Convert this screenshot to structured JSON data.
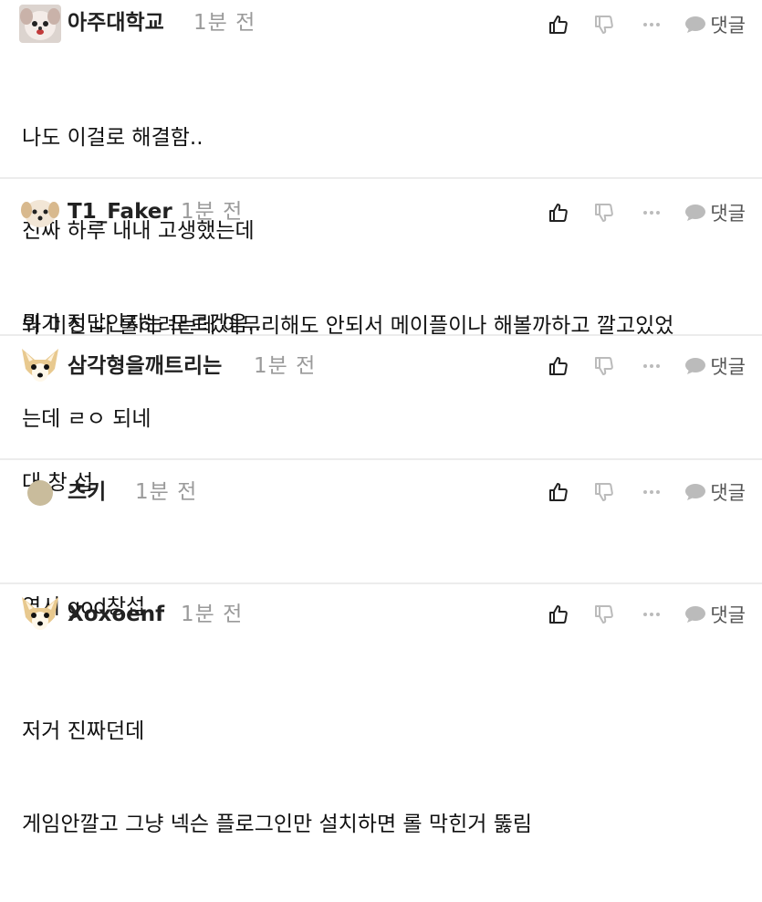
{
  "reply_label": "댓글",
  "comments": [
    {
      "username": "아주대학교",
      "time": "1분 전",
      "avatar": "dog-avatar-icon",
      "lines": [
        "나도 이걸로 해결함..",
        "진짜 하루 내내 고생했는데",
        "뭐가 정답인지는 모르겠음.."
      ]
    },
    {
      "username": "T1_Faker",
      "time": "1분 전",
      "avatar": "puppy-avatar-icon",
      "lines": [
        "와 미친 나 롤하려는데 아무리해도 안되서 메이플이나 해볼까하고 깔고있었",
        "는데 ㄹㅇ 되네"
      ]
    },
    {
      "username": "삼각형을깨트리는",
      "time": "1분 전",
      "avatar": "chihuahua-avatar-icon",
      "lines": [
        "대 창 섭"
      ]
    },
    {
      "username": "츠키",
      "time": "1분 전",
      "avatar": "default-avatar-icon",
      "lines": [
        "역시 god창섭"
      ]
    },
    {
      "username": "Xoxoenf",
      "time": "1분 전",
      "avatar": "chihuahua-avatar-icon",
      "lines": [
        "저거 진짜던데",
        "게임안깔고 그냥 넥슨 플로그인만 설치하면 롤 막힌거 뚫림"
      ]
    }
  ]
}
